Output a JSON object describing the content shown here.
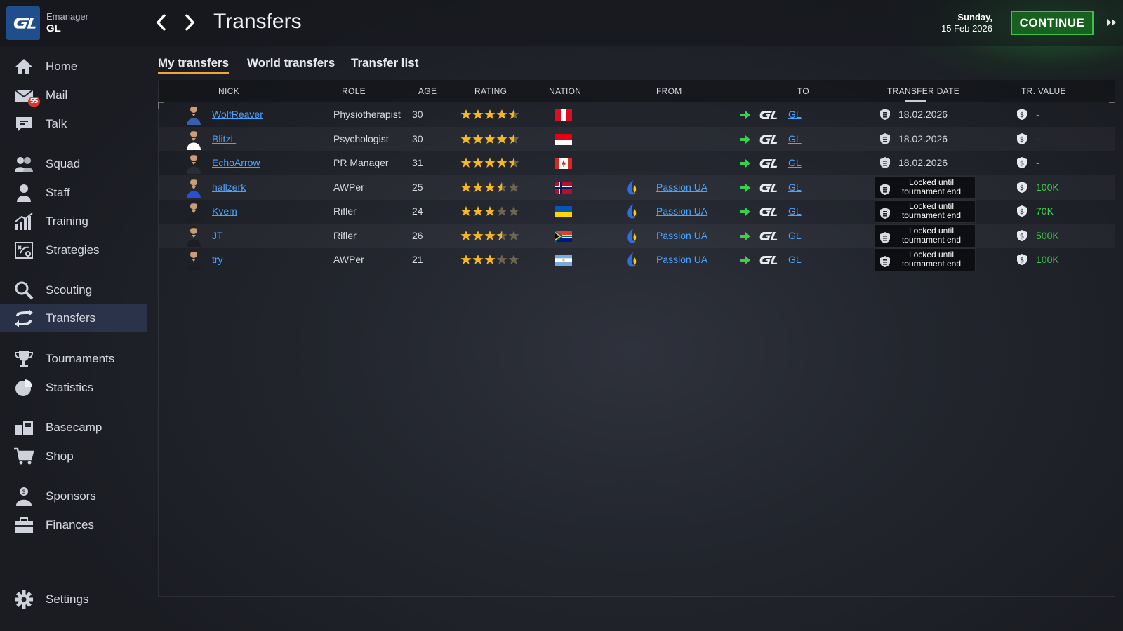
{
  "header": {
    "manager_label": "Emanager",
    "team_label": "GL",
    "page_title": "Transfers",
    "date_day": "Sunday,",
    "date_full": "15 Feb 2026",
    "continue_label": "CONTINUE"
  },
  "colors": {
    "accent_green": "#3ad04a",
    "link_blue": "#4aa3ff",
    "tab_underline": "#f0a63a",
    "star_gold": "#f5b820",
    "badge_red": "#e0332f"
  },
  "sidebar": {
    "items": [
      {
        "label": "Home",
        "icon": "home-icon"
      },
      {
        "label": "Mail",
        "icon": "mail-icon",
        "badge": "55"
      },
      {
        "label": "Talk",
        "icon": "chat-icon"
      },
      {
        "label": "Squad",
        "icon": "squad-icon"
      },
      {
        "label": "Staff",
        "icon": "staff-icon"
      },
      {
        "label": "Training",
        "icon": "training-icon"
      },
      {
        "label": "Strategies",
        "icon": "strategies-icon"
      },
      {
        "label": "Scouting",
        "icon": "magnifier-icon"
      },
      {
        "label": "Transfers",
        "icon": "transfer-arrows-icon",
        "active": true
      },
      {
        "label": "Tournaments",
        "icon": "trophy-icon"
      },
      {
        "label": "Statistics",
        "icon": "pie-chart-icon"
      },
      {
        "label": "Basecamp",
        "icon": "basecamp-icon"
      },
      {
        "label": "Shop",
        "icon": "cart-icon"
      },
      {
        "label": "Sponsors",
        "icon": "sponsor-icon"
      },
      {
        "label": "Finances",
        "icon": "briefcase-icon"
      },
      {
        "label": "Settings",
        "icon": "gear-icon"
      }
    ]
  },
  "tabs": [
    {
      "label": "My transfers",
      "active": true
    },
    {
      "label": "World transfers"
    },
    {
      "label": "Transfer list"
    }
  ],
  "table": {
    "columns": {
      "nick": "NICK",
      "role": "ROLE",
      "age": "AGE",
      "rating": "RATING",
      "nation": "NATION",
      "from": "FROM",
      "to": "TO",
      "transfer_date": "TRANSFER DATE",
      "tr_value": "TR. VALUE"
    },
    "rows": [
      {
        "nick": "WolfReaver",
        "role": "Physiotherapist",
        "age": "30",
        "rating": 4.5,
        "nation": "peru",
        "from": "",
        "to": "GL",
        "transfer_date": "18.02.2026",
        "locked": false,
        "value": "-"
      },
      {
        "nick": "BlitzL",
        "role": "Psychologist",
        "age": "30",
        "rating": 4.5,
        "nation": "indonesia",
        "from": "",
        "to": "GL",
        "transfer_date": "18.02.2026",
        "locked": false,
        "value": "-"
      },
      {
        "nick": "EchoArrow",
        "role": "PR Manager",
        "age": "31",
        "rating": 4.5,
        "nation": "canada",
        "from": "",
        "to": "GL",
        "transfer_date": "18.02.2026",
        "locked": false,
        "value": "-"
      },
      {
        "nick": "hallzerk",
        "role": "AWPer",
        "age": "25",
        "rating": 3.5,
        "nation": "norway",
        "from": "Passion UA",
        "to": "GL",
        "transfer_date": "Locked until tournament end",
        "locked": true,
        "value": "100K"
      },
      {
        "nick": "Kvem",
        "role": "Rifler",
        "age": "24",
        "rating": 3,
        "nation": "ukraine",
        "from": "Passion UA",
        "to": "GL",
        "transfer_date": "Locked until tournament end",
        "locked": true,
        "value": "70K"
      },
      {
        "nick": "JT",
        "role": "Rifler",
        "age": "26",
        "rating": 3.5,
        "nation": "south-africa",
        "from": "Passion UA",
        "to": "GL",
        "transfer_date": "Locked until tournament end",
        "locked": true,
        "value": "500K"
      },
      {
        "nick": "try",
        "role": "AWPer",
        "age": "21",
        "rating": 3,
        "nation": "argentina",
        "from": "Passion UA",
        "to": "GL",
        "transfer_date": "Locked until tournament end",
        "locked": true,
        "value": "100K"
      }
    ]
  }
}
